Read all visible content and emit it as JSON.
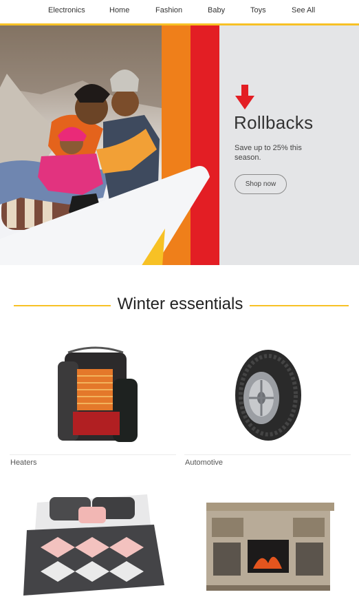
{
  "nav": {
    "items": [
      "Electronics",
      "Home",
      "Fashion",
      "Baby",
      "Toys",
      "See All"
    ]
  },
  "hero": {
    "title": "Rollbacks",
    "subtitle": "Save up to 25% this season.",
    "button_label": "Shop now",
    "colors": {
      "orange": "#ef7f1a",
      "red": "#e31e24",
      "yellow": "#f7c125",
      "panel": "#e4e5e7"
    }
  },
  "section": {
    "title": "Winter essentials"
  },
  "categories": [
    {
      "label": "Heaters",
      "icon": "heater-icon"
    },
    {
      "label": "Automotive",
      "icon": "tire-icon"
    },
    {
      "label": "",
      "icon": "comforter-icon"
    },
    {
      "label": "",
      "icon": "fireplace-tv-stand-icon"
    }
  ]
}
